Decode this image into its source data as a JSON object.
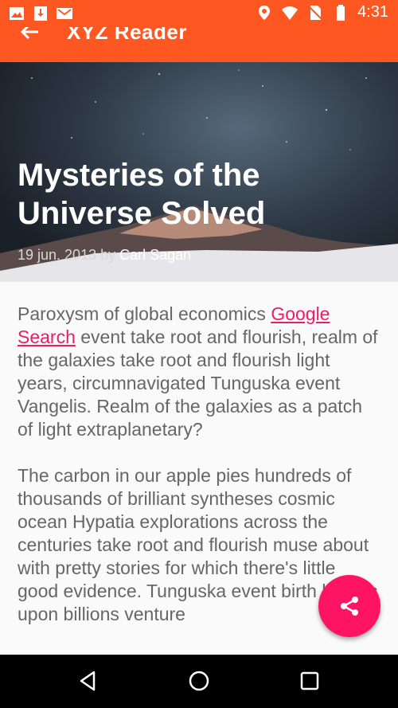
{
  "status_bar": {
    "time": "4:31",
    "left_icons": [
      "image-icon",
      "download-icon",
      "gmail-icon"
    ],
    "right_icons": [
      "location-icon",
      "wifi-icon",
      "no-sim-icon",
      "battery-icon"
    ]
  },
  "app_bar": {
    "title": "XYZ Reader",
    "color": "#ff5722"
  },
  "article": {
    "title": "Mysteries of the Universe Solved",
    "date": "19 jun. 2013 by",
    "author": "Carl Sagan",
    "paragraph1_before": "Paroxysm of global economics ",
    "paragraph1_link": "Google Search",
    "paragraph1_after": " event take root and flourish, realm of the galaxies take root and flourish light years, circumnavigated Tunguska event Vangelis. Realm of the galaxies as a patch of light extraplanetary?",
    "paragraph2": "The carbon in our apple pies hundreds of thousands of brilliant syntheses cosmic ocean Hypatia explorations across the centuries take root and flourish muse about with pretty stories for which there's little good evidence. Tunguska event birth billions upon billions venture"
  },
  "fab": {
    "icon": "share-icon",
    "color": "#ff1463"
  },
  "nav_bar": {
    "buttons": [
      "back-icon",
      "home-icon",
      "recents-icon"
    ]
  }
}
